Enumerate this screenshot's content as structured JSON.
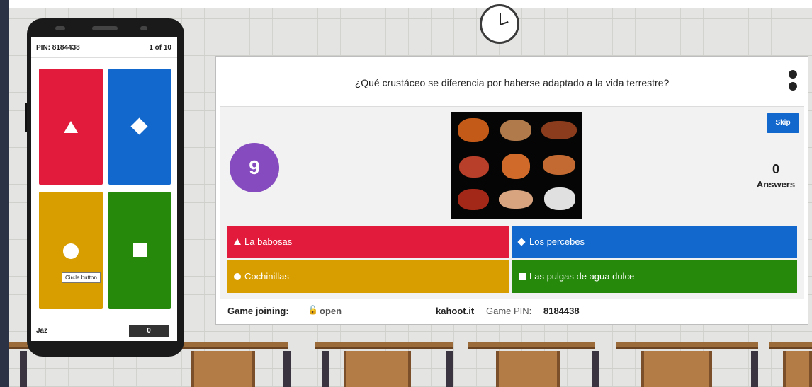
{
  "phone": {
    "pin_label": "PIN: 8184438",
    "question_counter": "1 of 10",
    "tooltip": "Circle button",
    "player_name": "Jaz",
    "score": "0"
  },
  "quiz": {
    "question": "¿Qué crustáceo se diferencia por haberse adaptado a la  vida terrestre?",
    "timer": "9",
    "skip_label": "Skip",
    "answers_count": "0",
    "answers_label": "Answers",
    "options": [
      {
        "label": "La babosas",
        "shape": "triangle",
        "color": "#e21b3c"
      },
      {
        "label": "Los percebes",
        "shape": "diamond",
        "color": "#1368ce"
      },
      {
        "label": "Cochinillas",
        "shape": "circle",
        "color": "#d89e00"
      },
      {
        "label": "Las pulgas de agua dulce",
        "shape": "square",
        "color": "#26890c"
      }
    ]
  },
  "footer": {
    "join_label": "Game joining:",
    "join_icon": "lock-open-icon",
    "join_status": "open",
    "site": "kahoot.it",
    "pin_label": "Game PIN:",
    "pin_value": "8184438"
  },
  "colors": {
    "timer_purple": "#864cbf",
    "accent_blue": "#1368ce"
  }
}
